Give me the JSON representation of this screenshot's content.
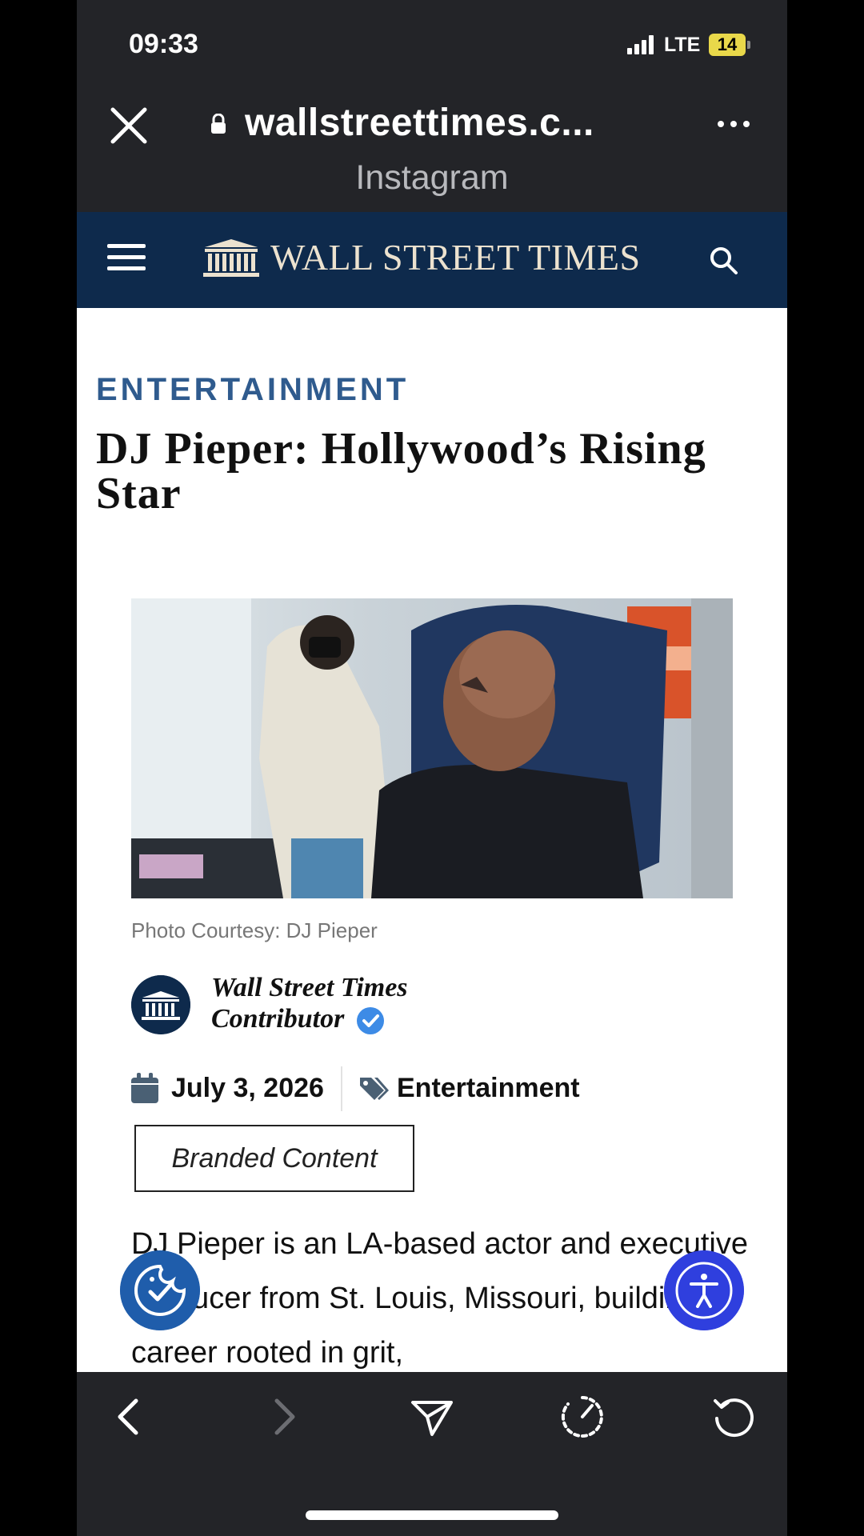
{
  "status_bar": {
    "time": "09:33",
    "network": "LTE",
    "battery": "14"
  },
  "browser": {
    "url": "wallstreettimes.c...",
    "source": "Instagram"
  },
  "site": {
    "brand": "WALL STREET TIMES"
  },
  "article": {
    "category_kicker": "ENTERTAINMENT",
    "headline": "DJ Pieper: Hollywood’s Rising Star",
    "photo_caption": "Photo Courtesy: DJ Pieper",
    "author_line1": "Wall Street Times",
    "author_line2": "Contributor",
    "date": "July 3, 2026",
    "category": "Entertainment",
    "label": "Branded Content",
    "body": "DJ Pieper is an LA-based actor and executive producer from St. Louis, Missouri, building a career rooted in grit,"
  },
  "colors": {
    "header_bg": "#0e2a4c",
    "kicker": "#2f5b8e",
    "a11y_button": "#2f3fde",
    "cookie_button": "#1f5dab"
  },
  "icons": [
    "close-icon",
    "lock-icon",
    "more-icon",
    "menu-icon",
    "logo-icon",
    "search-icon",
    "verified-icon",
    "calendar-icon",
    "tag-icon",
    "cookie-consent-icon",
    "accessibility-icon",
    "back-icon",
    "forward-icon",
    "share-icon",
    "speed-icon",
    "reload-icon"
  ]
}
